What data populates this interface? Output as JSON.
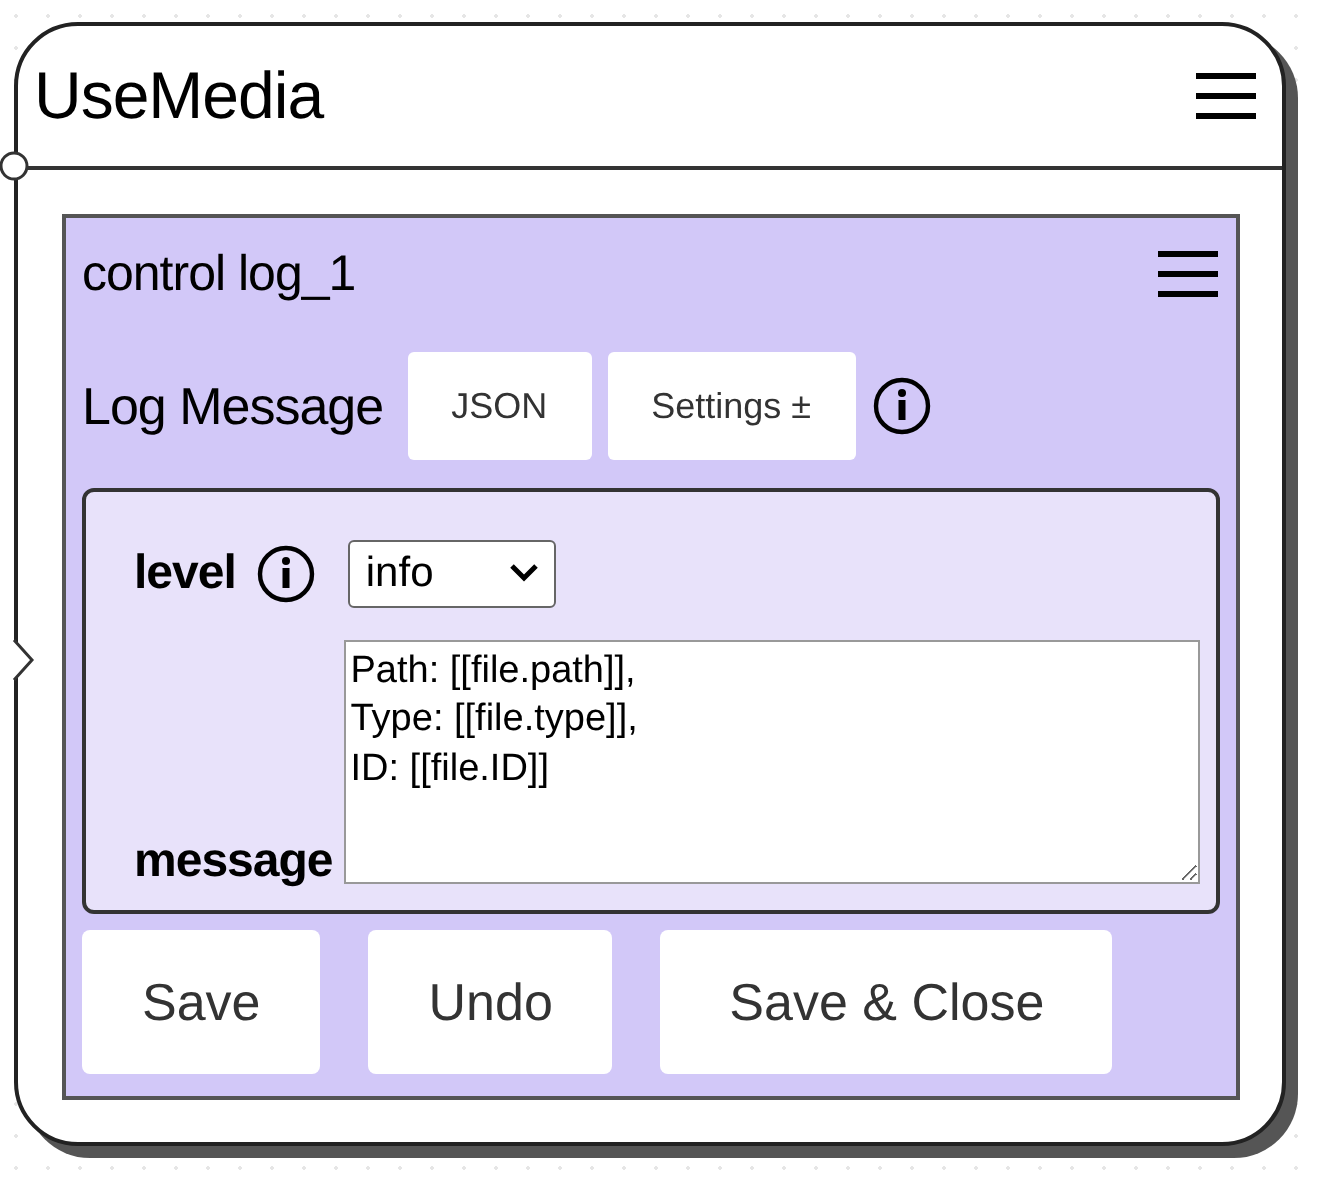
{
  "node": {
    "title": "UseMedia"
  },
  "panel": {
    "title": "control log_1",
    "heading": "Log Message",
    "tool_buttons": [
      "JSON",
      "Settings ±"
    ]
  },
  "form": {
    "level": {
      "label": "level",
      "value": "info"
    },
    "message": {
      "label": "message",
      "value": "Path: [[file.path]],\nType: [[file.type]],\nID: [[file.ID]]"
    }
  },
  "buttons": [
    "Save",
    "Undo",
    "Save & Close"
  ]
}
